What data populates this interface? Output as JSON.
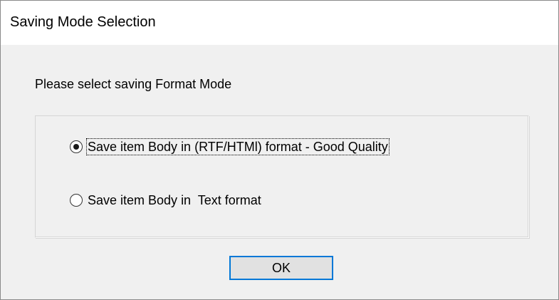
{
  "window": {
    "title": "Saving Mode Selection"
  },
  "dialog": {
    "prompt": "Please select saving Format Mode",
    "options": [
      {
        "label": "Save item Body in (RTF/HTMl) format - Good Quality",
        "selected": true,
        "focused": true
      },
      {
        "label": "Save item Body in  Text format",
        "selected": false,
        "focused": false
      }
    ],
    "ok_label": "OK"
  },
  "colors": {
    "title_bar": "#ffffff",
    "client_bg": "#f0f0f0",
    "button_bg": "#e1e1e1",
    "button_focus_border": "#0078d7",
    "group_border": "#d5d5d5"
  },
  "icons": {
    "selected_radio": "radio-selected-icon",
    "unselected_radio": "radio-unselected-icon"
  }
}
